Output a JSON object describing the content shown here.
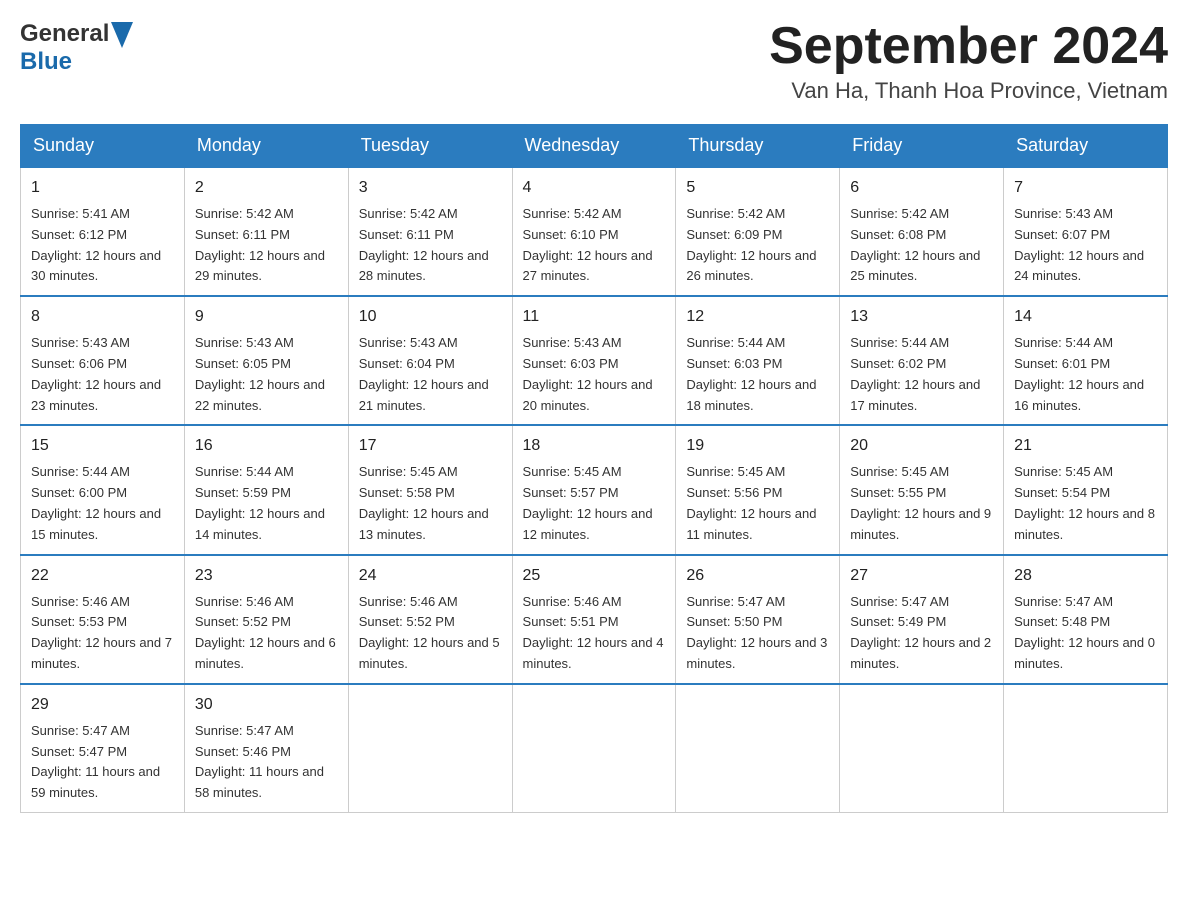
{
  "header": {
    "logo": {
      "general": "General",
      "blue": "Blue",
      "tagline": ""
    },
    "month_title": "September 2024",
    "location": "Van Ha, Thanh Hoa Province, Vietnam"
  },
  "days_of_week": [
    "Sunday",
    "Monday",
    "Tuesday",
    "Wednesday",
    "Thursday",
    "Friday",
    "Saturday"
  ],
  "weeks": [
    [
      {
        "day": "1",
        "sunrise": "Sunrise: 5:41 AM",
        "sunset": "Sunset: 6:12 PM",
        "daylight": "Daylight: 12 hours and 30 minutes."
      },
      {
        "day": "2",
        "sunrise": "Sunrise: 5:42 AM",
        "sunset": "Sunset: 6:11 PM",
        "daylight": "Daylight: 12 hours and 29 minutes."
      },
      {
        "day": "3",
        "sunrise": "Sunrise: 5:42 AM",
        "sunset": "Sunset: 6:11 PM",
        "daylight": "Daylight: 12 hours and 28 minutes."
      },
      {
        "day": "4",
        "sunrise": "Sunrise: 5:42 AM",
        "sunset": "Sunset: 6:10 PM",
        "daylight": "Daylight: 12 hours and 27 minutes."
      },
      {
        "day": "5",
        "sunrise": "Sunrise: 5:42 AM",
        "sunset": "Sunset: 6:09 PM",
        "daylight": "Daylight: 12 hours and 26 minutes."
      },
      {
        "day": "6",
        "sunrise": "Sunrise: 5:42 AM",
        "sunset": "Sunset: 6:08 PM",
        "daylight": "Daylight: 12 hours and 25 minutes."
      },
      {
        "day": "7",
        "sunrise": "Sunrise: 5:43 AM",
        "sunset": "Sunset: 6:07 PM",
        "daylight": "Daylight: 12 hours and 24 minutes."
      }
    ],
    [
      {
        "day": "8",
        "sunrise": "Sunrise: 5:43 AM",
        "sunset": "Sunset: 6:06 PM",
        "daylight": "Daylight: 12 hours and 23 minutes."
      },
      {
        "day": "9",
        "sunrise": "Sunrise: 5:43 AM",
        "sunset": "Sunset: 6:05 PM",
        "daylight": "Daylight: 12 hours and 22 minutes."
      },
      {
        "day": "10",
        "sunrise": "Sunrise: 5:43 AM",
        "sunset": "Sunset: 6:04 PM",
        "daylight": "Daylight: 12 hours and 21 minutes."
      },
      {
        "day": "11",
        "sunrise": "Sunrise: 5:43 AM",
        "sunset": "Sunset: 6:03 PM",
        "daylight": "Daylight: 12 hours and 20 minutes."
      },
      {
        "day": "12",
        "sunrise": "Sunrise: 5:44 AM",
        "sunset": "Sunset: 6:03 PM",
        "daylight": "Daylight: 12 hours and 18 minutes."
      },
      {
        "day": "13",
        "sunrise": "Sunrise: 5:44 AM",
        "sunset": "Sunset: 6:02 PM",
        "daylight": "Daylight: 12 hours and 17 minutes."
      },
      {
        "day": "14",
        "sunrise": "Sunrise: 5:44 AM",
        "sunset": "Sunset: 6:01 PM",
        "daylight": "Daylight: 12 hours and 16 minutes."
      }
    ],
    [
      {
        "day": "15",
        "sunrise": "Sunrise: 5:44 AM",
        "sunset": "Sunset: 6:00 PM",
        "daylight": "Daylight: 12 hours and 15 minutes."
      },
      {
        "day": "16",
        "sunrise": "Sunrise: 5:44 AM",
        "sunset": "Sunset: 5:59 PM",
        "daylight": "Daylight: 12 hours and 14 minutes."
      },
      {
        "day": "17",
        "sunrise": "Sunrise: 5:45 AM",
        "sunset": "Sunset: 5:58 PM",
        "daylight": "Daylight: 12 hours and 13 minutes."
      },
      {
        "day": "18",
        "sunrise": "Sunrise: 5:45 AM",
        "sunset": "Sunset: 5:57 PM",
        "daylight": "Daylight: 12 hours and 12 minutes."
      },
      {
        "day": "19",
        "sunrise": "Sunrise: 5:45 AM",
        "sunset": "Sunset: 5:56 PM",
        "daylight": "Daylight: 12 hours and 11 minutes."
      },
      {
        "day": "20",
        "sunrise": "Sunrise: 5:45 AM",
        "sunset": "Sunset: 5:55 PM",
        "daylight": "Daylight: 12 hours and 9 minutes."
      },
      {
        "day": "21",
        "sunrise": "Sunrise: 5:45 AM",
        "sunset": "Sunset: 5:54 PM",
        "daylight": "Daylight: 12 hours and 8 minutes."
      }
    ],
    [
      {
        "day": "22",
        "sunrise": "Sunrise: 5:46 AM",
        "sunset": "Sunset: 5:53 PM",
        "daylight": "Daylight: 12 hours and 7 minutes."
      },
      {
        "day": "23",
        "sunrise": "Sunrise: 5:46 AM",
        "sunset": "Sunset: 5:52 PM",
        "daylight": "Daylight: 12 hours and 6 minutes."
      },
      {
        "day": "24",
        "sunrise": "Sunrise: 5:46 AM",
        "sunset": "Sunset: 5:52 PM",
        "daylight": "Daylight: 12 hours and 5 minutes."
      },
      {
        "day": "25",
        "sunrise": "Sunrise: 5:46 AM",
        "sunset": "Sunset: 5:51 PM",
        "daylight": "Daylight: 12 hours and 4 minutes."
      },
      {
        "day": "26",
        "sunrise": "Sunrise: 5:47 AM",
        "sunset": "Sunset: 5:50 PM",
        "daylight": "Daylight: 12 hours and 3 minutes."
      },
      {
        "day": "27",
        "sunrise": "Sunrise: 5:47 AM",
        "sunset": "Sunset: 5:49 PM",
        "daylight": "Daylight: 12 hours and 2 minutes."
      },
      {
        "day": "28",
        "sunrise": "Sunrise: 5:47 AM",
        "sunset": "Sunset: 5:48 PM",
        "daylight": "Daylight: 12 hours and 0 minutes."
      }
    ],
    [
      {
        "day": "29",
        "sunrise": "Sunrise: 5:47 AM",
        "sunset": "Sunset: 5:47 PM",
        "daylight": "Daylight: 11 hours and 59 minutes."
      },
      {
        "day": "30",
        "sunrise": "Sunrise: 5:47 AM",
        "sunset": "Sunset: 5:46 PM",
        "daylight": "Daylight: 11 hours and 58 minutes."
      },
      null,
      null,
      null,
      null,
      null
    ]
  ]
}
